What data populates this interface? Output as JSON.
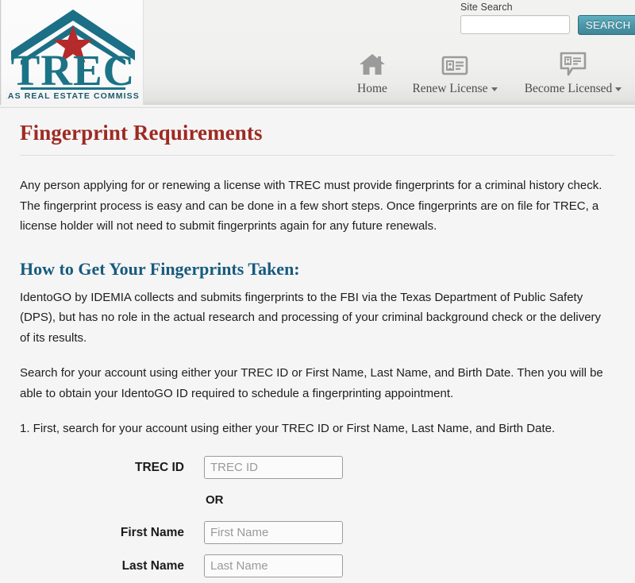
{
  "header": {
    "logo": {
      "name": "TREC",
      "tagline": "TEXAS REAL ESTATE COMMISSION",
      "primary_color": "#1b7385",
      "star_color": "#b52a2a"
    },
    "search": {
      "label": "Site Search",
      "input_value": "",
      "input_placeholder": "",
      "button_label": "SEARCH",
      "button_color": "#4e9aac"
    },
    "nav": [
      {
        "label": "Home",
        "icon": "home-icon",
        "has_caret": false
      },
      {
        "label": "Renew License",
        "icon": "id-card-icon",
        "has_caret": true
      },
      {
        "label": "Become Licensed",
        "icon": "id-card-speech-bubble-icon",
        "has_caret": true
      }
    ]
  },
  "page": {
    "title": "Fingerprint Requirements",
    "title_color": "#9e2a22",
    "paragraph_intro": "Any person applying for or renewing a license with TREC must provide fingerprints for a criminal history check. The fingerprint process is easy and can be done in a few short steps. Once fingerprints are on file for TREC, a license holder will not need to submit fingerprints again for any future renewals.",
    "section_heading": "How to Get Your Fingerprints Taken:",
    "section_heading_color": "#175b7e",
    "paragraph_identogo": "IdentoGO by IDEMIA collects and submits fingerprints to the FBI via the Texas Department of Public Safety (DPS), but has no role in the actual research and processing of your criminal background check or the delivery of its results.",
    "paragraph_search": "Search for your account using either your TREC ID or First Name, Last Name, and Birth Date. Then you will be able to obtain your IdentoGO ID required to schedule a fingerprinting appointment.",
    "paragraph_step1": "1. First, search for your account using either your TREC ID or First Name, Last Name, and Birth Date."
  },
  "form": {
    "trec_id": {
      "label": "TREC ID",
      "value": "",
      "placeholder": "TREC ID"
    },
    "or_text": "OR",
    "first_name": {
      "label": "First Name",
      "value": "",
      "placeholder": "First Name"
    },
    "last_name": {
      "label": "Last Name",
      "value": "",
      "placeholder": "Last Name"
    }
  }
}
